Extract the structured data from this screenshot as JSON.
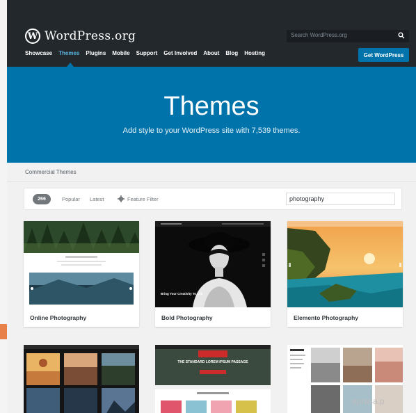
{
  "header": {
    "logo_letter": "W",
    "logo_text": "WordPress.org",
    "search_placeholder": "Search WordPress.org",
    "get_button": "Get WordPress",
    "nav": [
      "Showcase",
      "Themes",
      "Plugins",
      "Mobile",
      "Support",
      "Get Involved",
      "About",
      "Blog",
      "Hosting"
    ],
    "active_nav": "Themes"
  },
  "hero": {
    "title": "Themes",
    "subtitle": "Add style to your WordPress site with 7,539 themes."
  },
  "section_label": "Commercial Themes",
  "filter": {
    "count": "266",
    "popular": "Popular",
    "latest": "Latest",
    "feature_filter": "Feature Filter",
    "search_value": "photography"
  },
  "themes": [
    {
      "name": "Online Photography"
    },
    {
      "name": "Bold Photography",
      "screenshot_text": "Bring Your Creativity To Life"
    },
    {
      "name": "Elemento Photography"
    }
  ],
  "second_row": {
    "promo_text": "THE STANDARD LOREM IPSUM PASSAGE"
  },
  "watermark": "eprasa.p",
  "colors": {
    "header_bg": "#23282d",
    "accent": "#0073aa",
    "active_link": "#5ab1de",
    "page_bg": "#f1f1f1"
  }
}
